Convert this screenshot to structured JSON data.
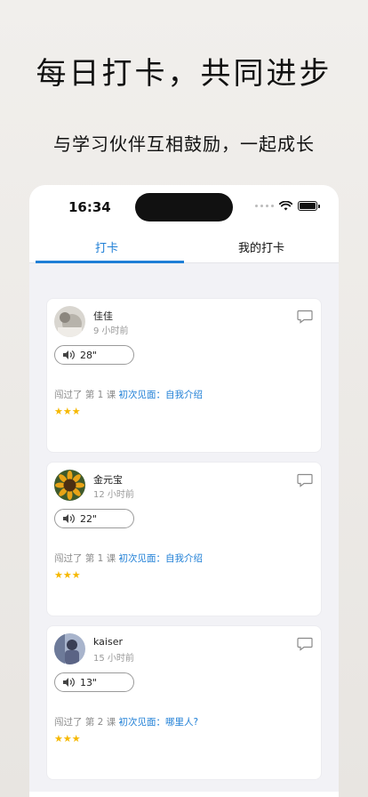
{
  "header": {
    "title": "每日打卡，共同进步",
    "subtitle": "与学习伙伴互相鼓励，一起成长"
  },
  "status_bar": {
    "time": "16:34"
  },
  "tabs": [
    {
      "label": "打卡",
      "active": true
    },
    {
      "label": "我的打卡",
      "active": false
    }
  ],
  "colors": {
    "accent": "#1f7fd6",
    "star": "#f6b800"
  },
  "posts": [
    {
      "name": "佳佳",
      "time_ago": "9 小时前",
      "voice_length": "28\"",
      "lesson_prefix": "闯过了 第 1 课",
      "lesson_title": "初次见面：自我介绍",
      "stars": "★★★"
    },
    {
      "name": "金元宝",
      "time_ago": "12 小时前",
      "voice_length": "22\"",
      "lesson_prefix": "闯过了 第 1 课",
      "lesson_title": "初次见面：自我介绍",
      "stars": "★★★"
    },
    {
      "name": "kaiser",
      "time_ago": "15 小时前",
      "voice_length": "13\"",
      "lesson_prefix": "闯过了 第 2 课",
      "lesson_title": "初次见面：哪里人?",
      "stars": "★★★"
    }
  ]
}
